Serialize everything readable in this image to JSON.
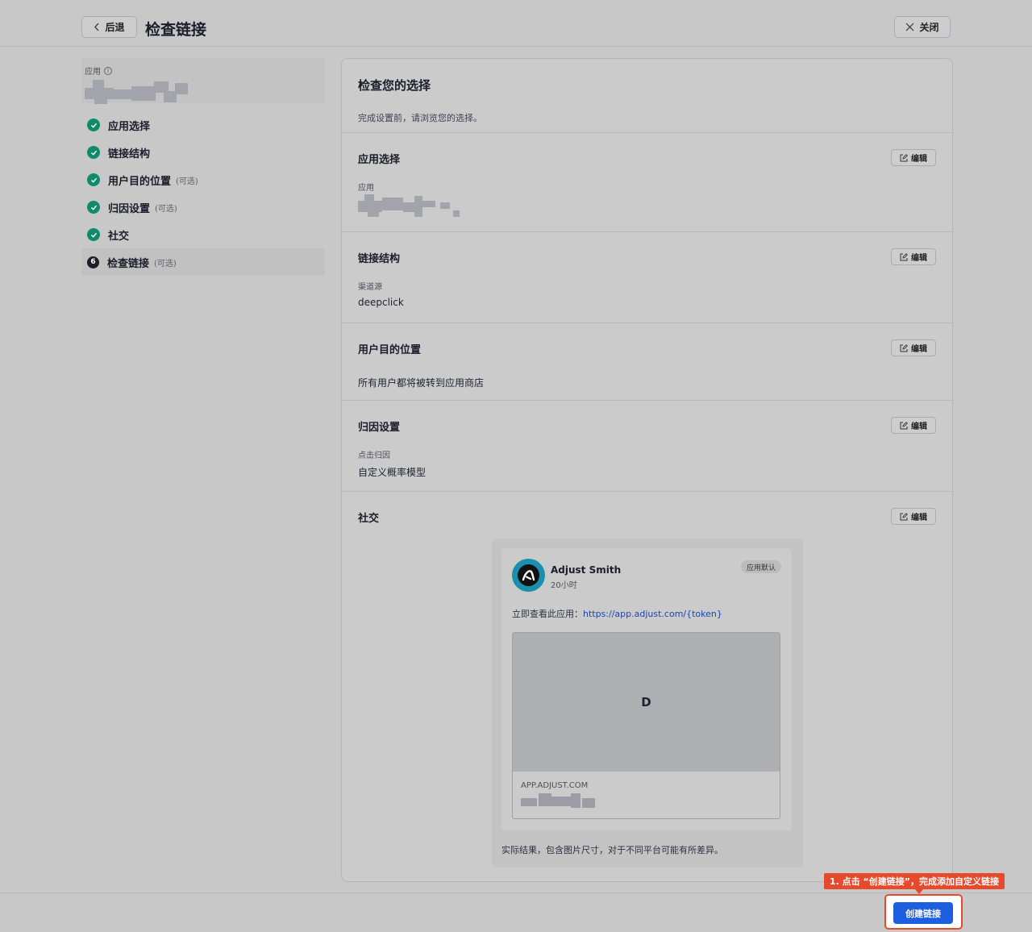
{
  "header": {
    "back_label": "后退",
    "title": "检查链接",
    "close_label": "关闭"
  },
  "sidebar": {
    "app_label": "应用",
    "steps": [
      {
        "label": "应用选择",
        "optional": "",
        "status": "done"
      },
      {
        "label": "链接结构",
        "optional": "",
        "status": "done"
      },
      {
        "label": "用户目的位置",
        "optional": "(可选)",
        "status": "done"
      },
      {
        "label": "归因设置",
        "optional": "(可选)",
        "status": "done"
      },
      {
        "label": "社交",
        "optional": "",
        "status": "done"
      },
      {
        "label": "检查链接",
        "optional": "(可选)",
        "status": "current",
        "number": "6"
      }
    ]
  },
  "main": {
    "title": "检查您的选择",
    "subtitle": "完成设置前，请浏览您的选择。",
    "edit_label": "编辑",
    "sections": {
      "app_selection": {
        "title": "应用选择",
        "field_label": "应用"
      },
      "link_structure": {
        "title": "链接结构",
        "field_label": "渠道源",
        "field_value": "deepclick"
      },
      "user_destination": {
        "title": "用户目的位置",
        "field_value": "所有用户都将被转到应用商店"
      },
      "attribution": {
        "title": "归因设置",
        "field_label": "点击归因",
        "field_value": "自定义概率模型"
      },
      "social": {
        "title": "社交",
        "post": {
          "author": "Adjust Smith",
          "time": "20小时",
          "badge": "应用默认",
          "text": "立即查看此应用：",
          "link": "https://app.adjust.com/{token}",
          "image_letter": "D",
          "domain": "APP.ADJUST.COM"
        },
        "note": "实际结果，包含图片尺寸，对于不同平台可能有所差异。"
      }
    }
  },
  "footer": {
    "tooltip": "1. 点击 “创建链接”，完成添加自定义链接",
    "create_label": "创建链接"
  },
  "colors": {
    "accent": "#1e5fe0",
    "success": "#108a6b",
    "annotation": "#e7492c"
  }
}
